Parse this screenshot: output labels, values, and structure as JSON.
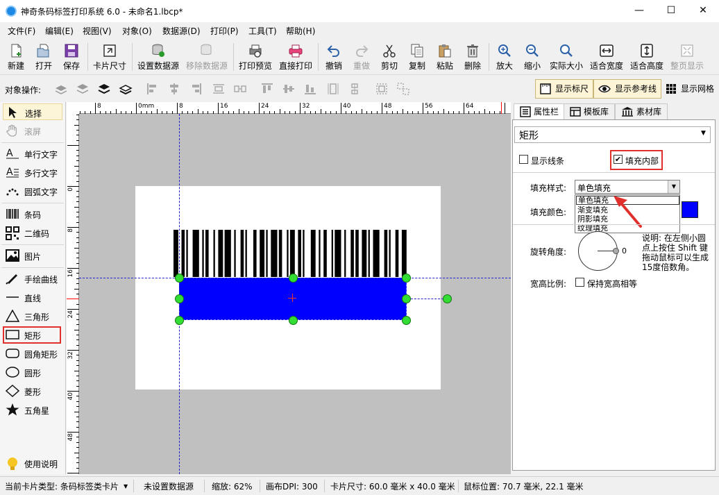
{
  "window": {
    "title": "神奇条码标签打印系统 6.0 - 未命名1.lbcp*",
    "minimize": "—",
    "maximize": "☐",
    "close": "✕"
  },
  "menu": [
    "文件(F)",
    "编辑(E)",
    "视图(V)",
    "对象(O)",
    "数据源(D)",
    "打印(P)",
    "工具(T)",
    "帮助(H)"
  ],
  "toolbar": [
    {
      "label": "新建",
      "icon": "new-file-icon"
    },
    {
      "label": "打开",
      "icon": "open-folder-icon"
    },
    {
      "label": "保存",
      "icon": "save-icon"
    },
    {
      "label": "卡片尺寸",
      "icon": "card-size-icon"
    },
    {
      "label": "设置数据源",
      "icon": "database-icon"
    },
    {
      "label": "移除数据源",
      "icon": "remove-database-icon",
      "disabled": true
    },
    {
      "label": "打印预览",
      "icon": "print-preview-icon"
    },
    {
      "label": "直接打印",
      "icon": "printer-icon"
    },
    {
      "label": "撤销",
      "icon": "undo-icon"
    },
    {
      "label": "重做",
      "icon": "redo-icon",
      "disabled": true
    },
    {
      "label": "剪切",
      "icon": "scissors-icon"
    },
    {
      "label": "复制",
      "icon": "copy-icon"
    },
    {
      "label": "粘贴",
      "icon": "paste-icon"
    },
    {
      "label": "删除",
      "icon": "trash-icon"
    },
    {
      "label": "放大",
      "icon": "zoom-in-icon"
    },
    {
      "label": "缩小",
      "icon": "zoom-out-icon"
    },
    {
      "label": "实际大小",
      "icon": "zoom-actual-icon"
    },
    {
      "label": "适合宽度",
      "icon": "fit-width-icon"
    },
    {
      "label": "适合高度",
      "icon": "fit-height-icon"
    },
    {
      "label": "整页显示",
      "icon": "fit-page-icon",
      "disabled": true
    }
  ],
  "objbar": {
    "label": "对象操作:",
    "show_ruler": "显示标尺",
    "show_guides": "显示参考线",
    "show_grid": "显示网格"
  },
  "tools": {
    "select": "选择",
    "scroll": "滚屏",
    "single_text": "单行文字",
    "multi_text": "多行文字",
    "arc_text": "圆弧文字",
    "barcode": "条码",
    "qrcode": "二维码",
    "image": "图片",
    "freehand": "手绘曲线",
    "line": "直线",
    "triangle": "三角形",
    "rectangle": "矩形",
    "round_rect": "圆角矩形",
    "circle": "圆形",
    "diamond": "菱形",
    "star": "五角星",
    "help": "使用说明"
  },
  "ruler": {
    "h_labels": [
      "8",
      "0mm",
      "8",
      "16",
      "24",
      "32",
      "40",
      "48",
      "56",
      "64",
      "72"
    ],
    "v_labels": [
      "0",
      "8",
      "16",
      "24",
      "32",
      "40",
      "48"
    ]
  },
  "panel": {
    "tabs": [
      "属性栏",
      "模板库",
      "素材库"
    ],
    "object_type": "矩形",
    "show_border": "显示线条",
    "fill_inside": "填充内部",
    "fill_style_label": "填充样式:",
    "fill_style_value": "单色填充",
    "fill_color_label": "填充颜色:",
    "fill_color": "#0000ff",
    "fill_options": [
      "单色填充",
      "渐变填充",
      "阴影填充",
      "纹理填充"
    ],
    "rotation_label": "旋转角度:",
    "rotation_value": "0",
    "rotation_note": "说明: 在左侧小圆点上按住 Shift 键拖动鼠标可以生成15度倍数角。",
    "ratio_label": "宽高比例:",
    "keep_ratio": "保持宽高相等"
  },
  "status": {
    "card_type": "当前卡片类型: 条码标签类卡片",
    "datasource": "未设置数据源",
    "zoom": "缩放: 62%",
    "dpi": "画布DPI: 300",
    "card_size": "卡片尺寸: 60.0 毫米 x 40.0 毫米",
    "mouse_pos": "鼠标位置: 70.7 毫米, 22.1 毫米"
  }
}
